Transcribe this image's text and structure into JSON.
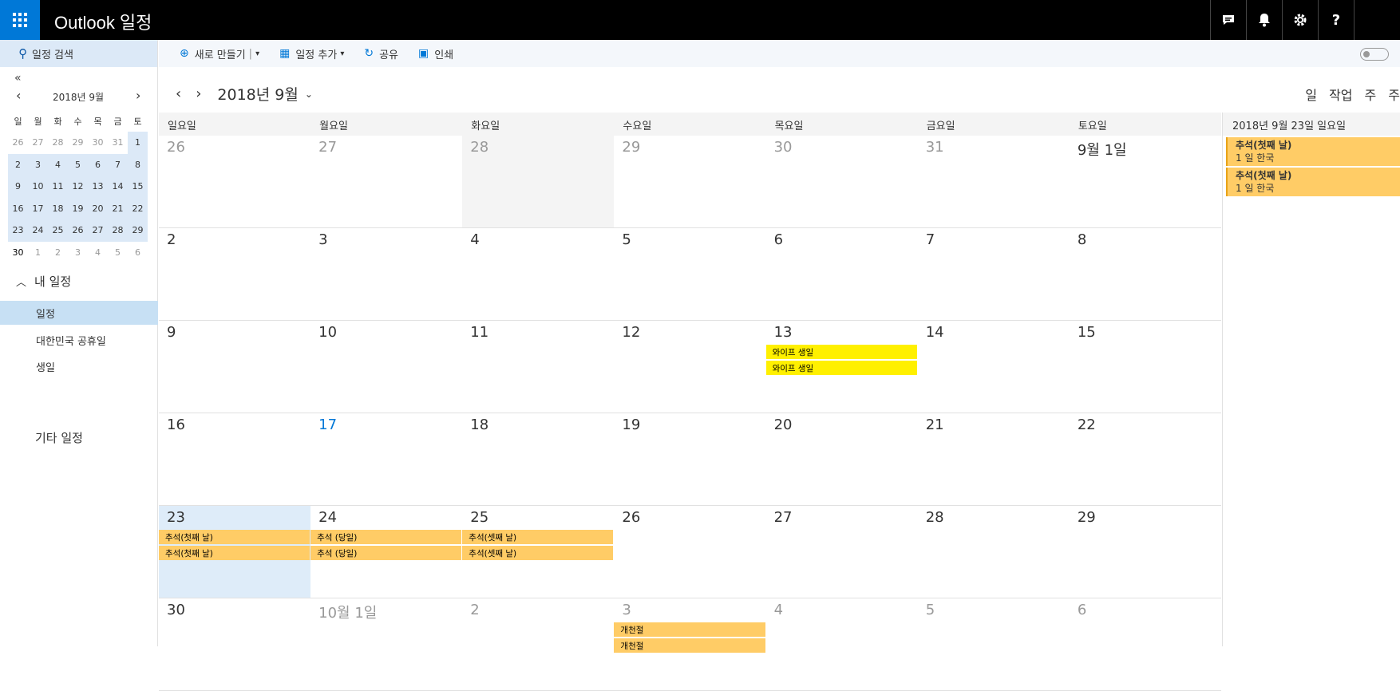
{
  "topbar": {
    "title": "Outlook 일정",
    "icons": [
      "chat-icon",
      "bell-icon",
      "gear-icon",
      "help-icon"
    ],
    "help_label": "?"
  },
  "sidebar": {
    "search_placeholder": "일정 검색",
    "collapse_label": "«",
    "mini_title": "2018년 9월",
    "dow": [
      "일",
      "월",
      "화",
      "수",
      "목",
      "금",
      "토"
    ],
    "days": [
      "26",
      "27",
      "28",
      "29",
      "30",
      "31",
      "1",
      "2",
      "3",
      "4",
      "5",
      "6",
      "7",
      "8",
      "9",
      "10",
      "11",
      "12",
      "13",
      "14",
      "15",
      "16",
      "17",
      "18",
      "19",
      "20",
      "21",
      "22",
      "23",
      "24",
      "25",
      "26",
      "27",
      "28",
      "29",
      "30",
      "1",
      "2",
      "3",
      "4",
      "5",
      "6"
    ],
    "my_calendars": "내 일정",
    "calendars": [
      "일정",
      "대한민국 공휴일",
      "생일"
    ],
    "other_calendars": "기타 일정"
  },
  "toolbar": {
    "new": "새로 만들기",
    "add_calendar": "일정 추가",
    "share": "공유",
    "print": "인쇄"
  },
  "header": {
    "month": "2018년 9월",
    "views": [
      "일",
      "작업",
      "주",
      "주"
    ]
  },
  "week_days": [
    "일요일",
    "월요일",
    "화요일",
    "수요일",
    "목요일",
    "금요일",
    "토요일"
  ],
  "weeks": [
    [
      {
        "d": "26"
      },
      {
        "d": "27"
      },
      {
        "d": "28"
      },
      {
        "d": "29"
      },
      {
        "d": "30"
      },
      {
        "d": "31"
      },
      {
        "d": "9월 1일"
      }
    ],
    [
      {
        "d": "2"
      },
      {
        "d": "3"
      },
      {
        "d": "4"
      },
      {
        "d": "5"
      },
      {
        "d": "6"
      },
      {
        "d": "7"
      },
      {
        "d": "8"
      }
    ],
    [
      {
        "d": "9"
      },
      {
        "d": "10"
      },
      {
        "d": "11"
      },
      {
        "d": "12"
      },
      {
        "d": "13",
        "ev": [
          {
            "t": "와이프 생일",
            "c": "yellow"
          },
          {
            "t": "와이프 생일",
            "c": "yellow"
          }
        ]
      },
      {
        "d": "14"
      },
      {
        "d": "15"
      }
    ],
    [
      {
        "d": "16"
      },
      {
        "d": "17"
      },
      {
        "d": "18"
      },
      {
        "d": "19"
      },
      {
        "d": "20"
      },
      {
        "d": "21"
      },
      {
        "d": "22"
      }
    ],
    [
      {
        "d": "23",
        "ev": [
          {
            "t": "추석(첫째 날)"
          },
          {
            "t": "추석(첫째 날)"
          }
        ]
      },
      {
        "d": "24",
        "ev": [
          {
            "t": "추석 (당일)"
          },
          {
            "t": "추석 (당일)"
          }
        ]
      },
      {
        "d": "25",
        "ev": [
          {
            "t": "추석(셋째 날)"
          },
          {
            "t": "추석(셋째 날)"
          }
        ]
      },
      {
        "d": "26"
      },
      {
        "d": "27"
      },
      {
        "d": "28"
      },
      {
        "d": "29"
      }
    ],
    [
      {
        "d": "30"
      },
      {
        "d": "10월 1일"
      },
      {
        "d": "2"
      },
      {
        "d": "3",
        "ev": [
          {
            "t": "개천절"
          },
          {
            "t": "개천절"
          }
        ]
      },
      {
        "d": "4"
      },
      {
        "d": "5"
      },
      {
        "d": "6"
      }
    ]
  ],
  "day_panel": {
    "title": "2018년 9월 23일 일요일",
    "events": [
      {
        "title": "추석(첫째 날)",
        "sub": "1 일  한국"
      },
      {
        "title": "추석(첫째 날)",
        "sub": "1 일  한국"
      }
    ]
  }
}
